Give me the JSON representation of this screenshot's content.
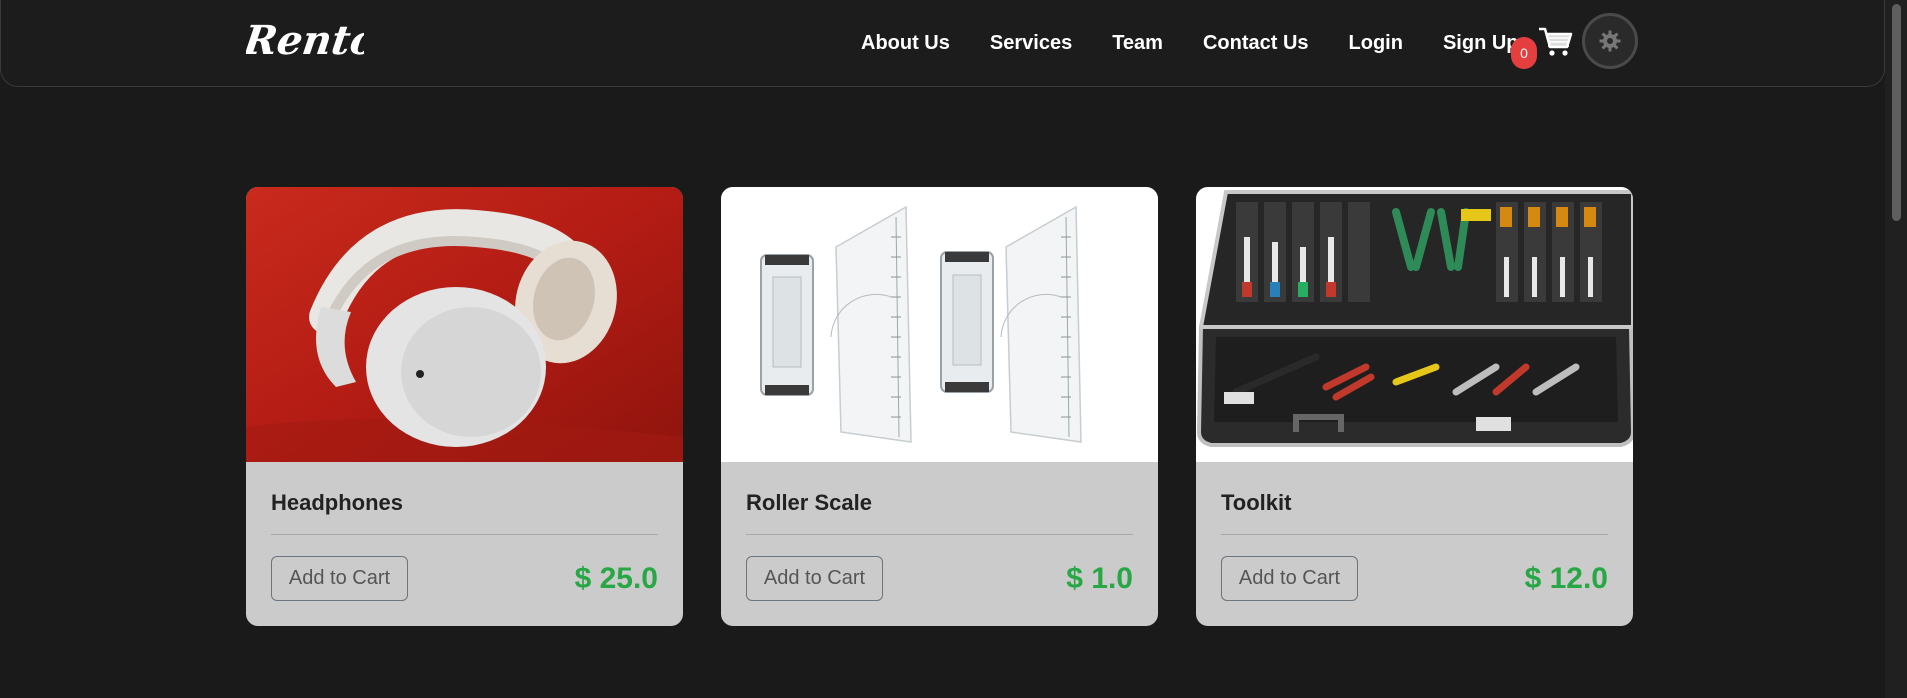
{
  "brand": {
    "logo_text": "Rento."
  },
  "nav": {
    "links": [
      "About Us",
      "Services",
      "Team",
      "Contact Us",
      "Login",
      "Sign Up"
    ],
    "cart_count": "0"
  },
  "products": [
    {
      "name": "Headphones",
      "price": "$ 25.0",
      "button": "Add to Cart"
    },
    {
      "name": "Roller Scale",
      "price": "$ 1.0",
      "button": "Add to Cart"
    },
    {
      "name": "Toolkit",
      "price": "$ 12.0",
      "button": "Add to Cart"
    }
  ],
  "colors": {
    "background": "#1a1a1a",
    "card": "#cbcbcb",
    "price": "#28a745",
    "badge": "#e53e3e"
  }
}
